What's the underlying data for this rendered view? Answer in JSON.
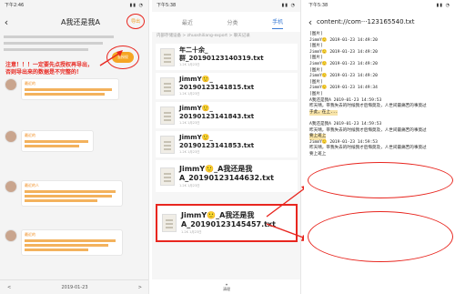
{
  "panel1": {
    "status_time": "下午2:46",
    "title": "A我还是我A",
    "export_label": "导出",
    "auth_button_label": "去授权",
    "warning_line1": "注意！！！一定要先点授权再导出，",
    "warning_line2": "否则导出来的数据是不完整的！",
    "chat_names": [
      "最近的",
      "最近的",
      "最近的人",
      "最近的"
    ],
    "bottom_left": "<",
    "bottom_date": "2019-01-23",
    "bottom_right": ">"
  },
  "panel2": {
    "status_time": "下午5:38",
    "tabs": [
      "最近",
      "分类",
      "手机"
    ],
    "active_tab": 2,
    "breadcrumb": "内部存储设备 > zhuoshiliang-export > 聊天记录",
    "files": [
      {
        "line1": "年二十余_",
        "line2": "群_20190123140319.txt",
        "meta": "1.2K  1月23日"
      },
      {
        "line1": "JimmY🙂_",
        "line2": "20190123141815.txt",
        "meta": "1.2K  1月23日"
      },
      {
        "line1": "JimmY🙂_",
        "line2": "20190123141843.txt",
        "meta": "1.2K  1月23日"
      },
      {
        "line1": "JimmY🙂_",
        "line2": "20190123141853.txt",
        "meta": "1.2K  1月23日"
      },
      {
        "line1": "JimmY🙂_A我还是我",
        "line2": "A_20190123144632.txt",
        "meta": "1.2K  1月23日"
      },
      {
        "line1": "JimmY🙂_A我还是我",
        "line2": "A_20190123145457.txt",
        "meta": "1.2K  1月23日"
      }
    ],
    "bottom_label": "清理"
  },
  "panel3": {
    "status_time": "下午5:38",
    "title": "content://com···123165540.txt",
    "log_lines": [
      "[图片]",
      "JimmY🙂 2019-01-23 14:49:20",
      "[图片]",
      "JimmY🙂 2019-01-23 14:49:20",
      "[图片]",
      "JimmY🙂 2019-01-23 14:49:20",
      "[图片]",
      "JimmY🙂 2019-01-23 14:49:20",
      "[图片]",
      "JimmY🙂 2019-01-23 14:49:34",
      "[图片]",
      "A我还是我A 2019-01-23 14:59:53",
      "昨天晴，带我失去的时候我才后悔莫及，人世间最痛苦的事莫过",
      "于此，在上...",
      "",
      "A我还是我A 2019-01-23 14:59:53",
      "昨天晴，带我失去的时候我才后悔莫及，人世间最痛苦的事莫过",
      "要上班上",
      "JimmY🙂 2019-01-23 14:59:53",
      "昨天晴，带我失去的时候我才后悔莫及，人世间最痛苦的事莫过",
      "要上班上"
    ]
  },
  "colors": {
    "annotation_red": "#e8261f",
    "accent_orange": "#f5a523",
    "tab_blue": "#3a7bd5"
  }
}
